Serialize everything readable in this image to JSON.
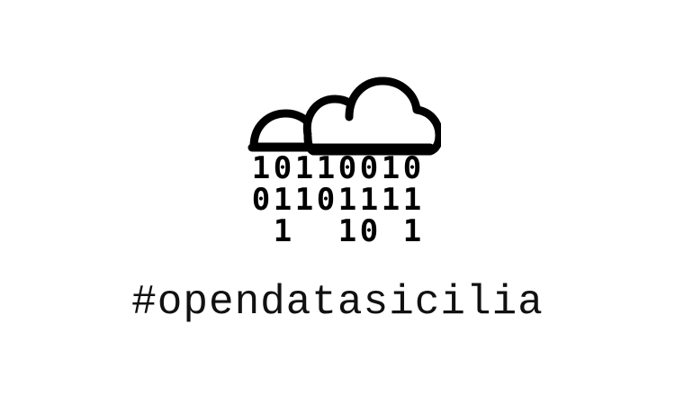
{
  "logo": {
    "icon": "cloud-binary-rain-icon",
    "binary_rows": [
      "10110010",
      "01101111",
      " 1  10 1"
    ]
  },
  "hashtag": "#opendatasicilia",
  "colors": {
    "background": "#ffffff",
    "foreground": "#000000"
  }
}
